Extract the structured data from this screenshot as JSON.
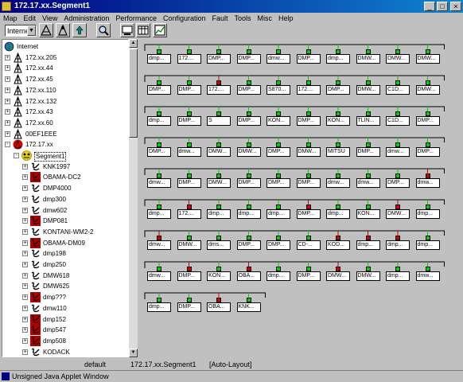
{
  "window": {
    "title": "172.17.xx.Segment1",
    "minimize": "_",
    "maximize": "□",
    "close": "×"
  },
  "menu": [
    "Map",
    "Edit",
    "View",
    "Administration",
    "Performance",
    "Configuration",
    "Fault",
    "Tools",
    "Misc",
    "Help"
  ],
  "toolbar": {
    "combo_value": "Internet"
  },
  "tree": [
    {
      "label": "Internet",
      "icon": "globe-icon",
      "indent": 0,
      "pm": ""
    },
    {
      "label": "172.xx.205",
      "icon": "network-icon",
      "indent": 1,
      "pm": "+"
    },
    {
      "label": "172.xx.44",
      "icon": "network-icon",
      "indent": 1,
      "pm": "+"
    },
    {
      "label": "172.xx.45",
      "icon": "network-icon",
      "indent": 1,
      "pm": "+"
    },
    {
      "label": "172.xx.110",
      "icon": "network-icon",
      "indent": 1,
      "pm": "+"
    },
    {
      "label": "172.xx.132",
      "icon": "network-icon",
      "indent": 1,
      "pm": "+"
    },
    {
      "label": "172.xx.43",
      "icon": "network-icon",
      "indent": 1,
      "pm": "+"
    },
    {
      "label": "172.xx.60",
      "icon": "network-icon",
      "indent": 1,
      "pm": "+"
    },
    {
      "label": "00EF1EEE",
      "icon": "network-icon",
      "indent": 1,
      "pm": "+"
    },
    {
      "label": "172.17.xx",
      "icon": "network-alarm-icon",
      "indent": 1,
      "pm": "-"
    },
    {
      "label": "Segment1",
      "icon": "segment-icon",
      "indent": 2,
      "pm": "-"
    },
    {
      "label": "KNK1997",
      "icon": "node-icon",
      "indent": 3,
      "pm": "+"
    },
    {
      "label": "OBAMA-DC2",
      "icon": "node-alarm-icon",
      "indent": 3,
      "pm": "+"
    },
    {
      "label": "DMP4000",
      "icon": "node-icon",
      "indent": 3,
      "pm": "+"
    },
    {
      "label": "dmp300",
      "icon": "node-icon",
      "indent": 3,
      "pm": "+"
    },
    {
      "label": "dmw602",
      "icon": "node-icon",
      "indent": 3,
      "pm": "+"
    },
    {
      "label": "DMP081",
      "icon": "node-alarm-icon",
      "indent": 3,
      "pm": "+"
    },
    {
      "label": "KONTANI-WM2-2",
      "icon": "node-icon",
      "indent": 3,
      "pm": "+"
    },
    {
      "label": "OBAMA-DM09",
      "icon": "node-alarm-icon",
      "indent": 3,
      "pm": "+"
    },
    {
      "label": "dmp198",
      "icon": "node-icon",
      "indent": 3,
      "pm": "+"
    },
    {
      "label": "dmp250",
      "icon": "node-icon",
      "indent": 3,
      "pm": "+"
    },
    {
      "label": "DMW618",
      "icon": "node-icon",
      "indent": 3,
      "pm": "+"
    },
    {
      "label": "DMW625",
      "icon": "node-icon",
      "indent": 3,
      "pm": "+"
    },
    {
      "label": "dmp???",
      "icon": "node-alarm-icon",
      "indent": 3,
      "pm": "+"
    },
    {
      "label": "dmw110",
      "icon": "node-icon",
      "indent": 3,
      "pm": "+"
    },
    {
      "label": "dmp152",
      "icon": "node-alarm-icon",
      "indent": 3,
      "pm": "+"
    },
    {
      "label": "dmp547",
      "icon": "node-alarm-icon",
      "indent": 3,
      "pm": "+"
    },
    {
      "label": "dmp508",
      "icon": "node-alarm-icon",
      "indent": 3,
      "pm": "+"
    },
    {
      "label": "KODACK",
      "icon": "node-icon",
      "indent": 3,
      "pm": "+"
    }
  ],
  "map_rows": [
    [
      [
        "dmp...",
        "g"
      ],
      [
        "172....",
        "g"
      ],
      [
        "DMP...",
        "g"
      ],
      [
        "DMP...",
        "g"
      ],
      [
        "dmw...",
        "g"
      ],
      [
        "DMP...",
        "g"
      ],
      [
        "dmp...",
        "g"
      ],
      [
        "DMW...",
        "g"
      ],
      [
        "DMW...",
        "g"
      ],
      [
        "DMW...",
        "g"
      ]
    ],
    [
      [
        "DMP...",
        "g"
      ],
      [
        "DMP...",
        "g"
      ],
      [
        "172....",
        "r"
      ],
      [
        "DMP...",
        "g"
      ],
      [
        "S870...",
        "g"
      ],
      [
        "172....",
        "g"
      ],
      [
        "DMP...",
        "g"
      ],
      [
        "DMW...",
        "g"
      ],
      [
        "C1D...",
        "g"
      ],
      [
        "DMW...",
        "g"
      ]
    ],
    [
      [
        "dmp...",
        "g"
      ],
      [
        "DMP...",
        "g"
      ],
      [
        "S",
        "g"
      ],
      [
        "DMP...",
        "g"
      ],
      [
        "KON...",
        "g"
      ],
      [
        "DMP...",
        "g"
      ],
      [
        "KON...",
        "g"
      ],
      [
        "TLIN...",
        "g"
      ],
      [
        "C1D...",
        "g"
      ],
      [
        "DMP...",
        "g"
      ]
    ],
    [
      [
        "DMP...",
        "g"
      ],
      [
        "dmw...",
        "g"
      ],
      [
        "DMW...",
        "g"
      ],
      [
        "DMW...",
        "g"
      ],
      [
        "DMP...",
        "g"
      ],
      [
        "DMW...",
        "g"
      ],
      [
        "MITSU",
        "g"
      ],
      [
        "DMP...",
        "g"
      ],
      [
        "dmw...",
        "g"
      ],
      [
        "DMP...",
        "g"
      ]
    ],
    [
      [
        "dmw...",
        "g"
      ],
      [
        "DMP...",
        "g"
      ],
      [
        "DMW...",
        "g"
      ],
      [
        "DMP...",
        "g"
      ],
      [
        "DMP...",
        "g"
      ],
      [
        "DMP...",
        "g"
      ],
      [
        "dmw...",
        "g"
      ],
      [
        "dmw...",
        "g"
      ],
      [
        "DMP...",
        "g"
      ],
      [
        "dmw...",
        "r"
      ]
    ],
    [
      [
        "dmp...",
        "g"
      ],
      [
        "172....",
        "r"
      ],
      [
        "dmp...",
        "g"
      ],
      [
        "dmp...",
        "g"
      ],
      [
        "dmp...",
        "g"
      ],
      [
        "DMP...",
        "r"
      ],
      [
        "dmp...",
        "g"
      ],
      [
        "KON...",
        "g"
      ],
      [
        "DMW...",
        "r"
      ],
      [
        "dmp...",
        "g"
      ]
    ],
    [
      [
        "dmw...",
        "r"
      ],
      [
        "DMW...",
        "g"
      ],
      [
        "dms...",
        "g"
      ],
      [
        "DMP...",
        "g"
      ],
      [
        "DMP...",
        "g"
      ],
      [
        "CD-...",
        "g"
      ],
      [
        "KOD...",
        "r"
      ],
      [
        "dmp...",
        "r"
      ],
      [
        "dmp...",
        "r"
      ],
      [
        "dmp...",
        "g"
      ]
    ],
    [
      [
        "dmw...",
        "g"
      ],
      [
        "DMP...",
        "r"
      ],
      [
        "KON...",
        "g"
      ],
      [
        "OBA...",
        "r"
      ],
      [
        "dmp...",
        "g"
      ],
      [
        "DMP...",
        "g"
      ],
      [
        "DMW...",
        "r"
      ],
      [
        "DMW...",
        "g"
      ],
      [
        "dmp...",
        "g"
      ],
      [
        "dmw...",
        "g"
      ]
    ],
    [
      [
        "dmp...",
        "g"
      ],
      [
        "DMP...",
        "g"
      ],
      [
        "OBA...",
        "r"
      ],
      [
        "KNK...",
        "g"
      ]
    ]
  ],
  "status": {
    "left": "default",
    "center": "172.17.xx.Segment1",
    "right": "[Auto-Layout]"
  },
  "appletbar": {
    "text": "Unsigned Java Applet Window"
  },
  "colors": {
    "ok": "#00d000",
    "alarm": "#d00000",
    "title_start": "#000080",
    "title_end": "#1084d0"
  }
}
